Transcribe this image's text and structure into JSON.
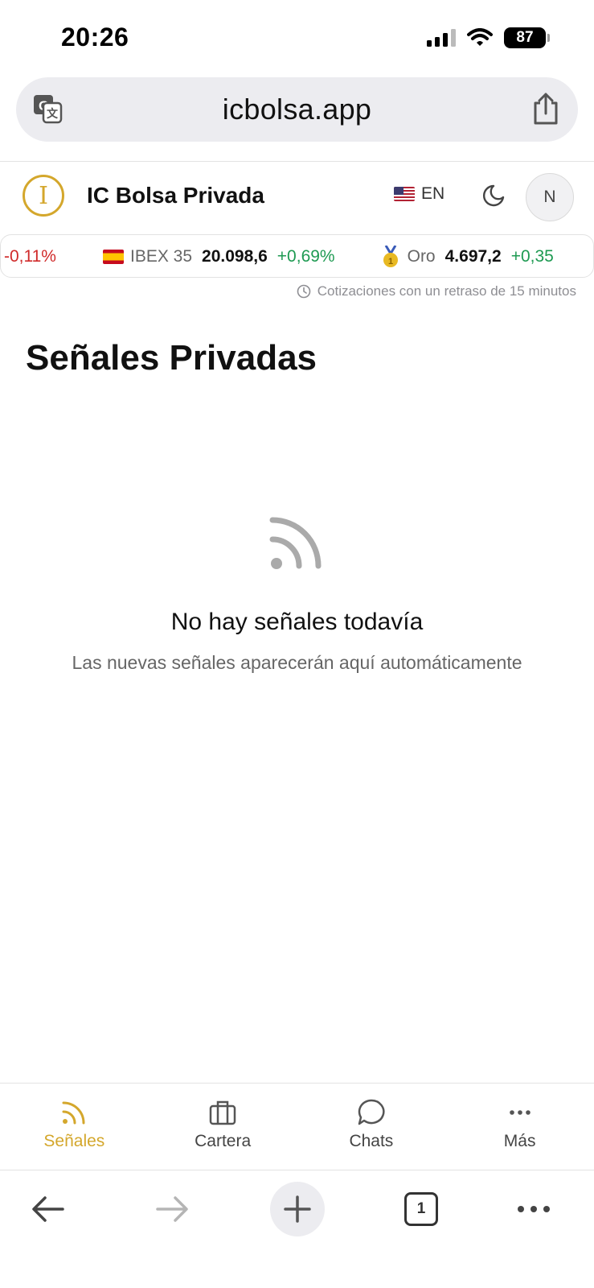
{
  "status_bar": {
    "time": "20:26",
    "battery": "87"
  },
  "browser": {
    "url": "icbolsa.app",
    "tab_count": "1"
  },
  "header": {
    "title": "IC Bolsa Privada",
    "logo_letter": "I",
    "language": "EN",
    "avatar_initial": "N"
  },
  "ticker": {
    "items": [
      {
        "name": "",
        "value": "",
        "change": "-0,11%",
        "direction": "down"
      },
      {
        "name": "IBEX 35",
        "value": "20.098,6",
        "change": "+0,69%",
        "direction": "up"
      },
      {
        "name": "Oro",
        "value": "4.697,2",
        "change": "+0,35",
        "direction": "up"
      }
    ],
    "delay_note": "Cotizaciones con un retraso de 15 minutos"
  },
  "page": {
    "title": "Señales Privadas"
  },
  "empty_state": {
    "icon": "rss-icon",
    "title": "No hay señales todavía",
    "subtitle": "Las nuevas señales aparecerán aquí automáticamente"
  },
  "tabs": [
    {
      "label": "Señales",
      "icon": "rss-icon",
      "active": true
    },
    {
      "label": "Cartera",
      "icon": "briefcase-icon",
      "active": false
    },
    {
      "label": "Chats",
      "icon": "chat-bubble-icon",
      "active": false
    },
    {
      "label": "Más",
      "icon": "more-horizontal-icon",
      "active": false
    }
  ],
  "colors": {
    "accent": "#d4a72c",
    "positive": "#1e9a52",
    "negative": "#d02a2a"
  }
}
